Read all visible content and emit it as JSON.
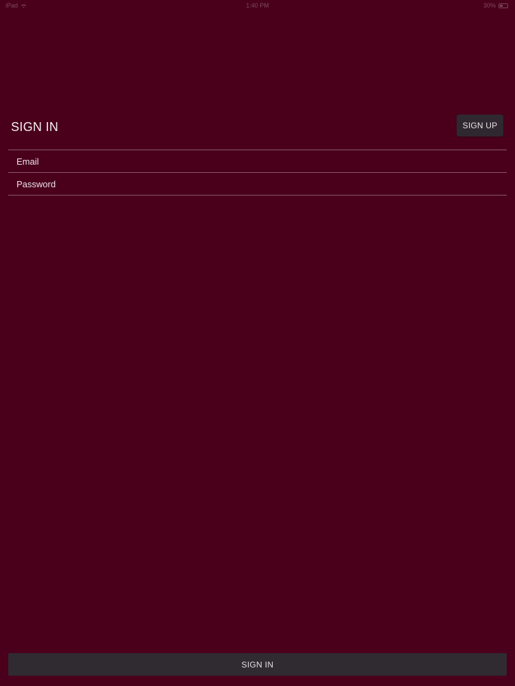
{
  "status_bar": {
    "time": "1:40 PM",
    "carrier": "iPad",
    "battery": "30%"
  },
  "header": {
    "title": "SIGN IN",
    "signup_label": "SIGN UP"
  },
  "form": {
    "email_placeholder": "Email",
    "email_value": "",
    "password_placeholder": "Password",
    "password_value": ""
  },
  "footer": {
    "signin_label": "SIGN IN"
  },
  "colors": {
    "background": "#4a001b",
    "button": "#302a31",
    "divider": "#7a5566"
  },
  "icons": {
    "wifi": "wifi-icon",
    "battery": "battery-icon"
  }
}
